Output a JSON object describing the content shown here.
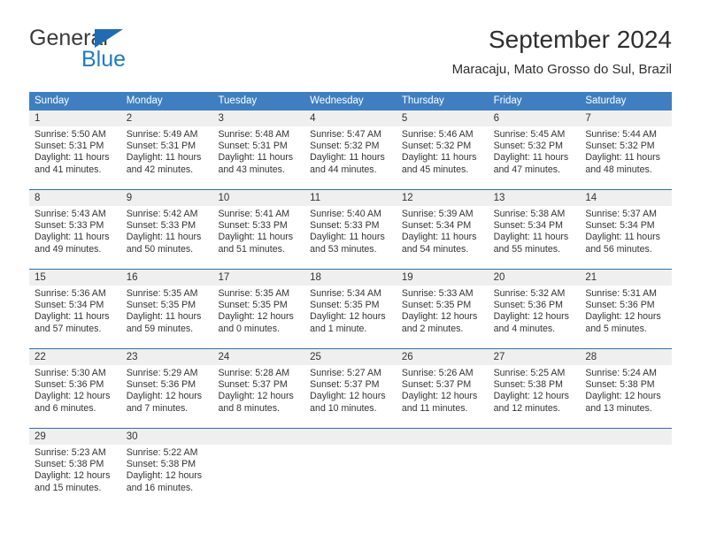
{
  "brand": {
    "line1": "General",
    "line2": "Blue",
    "triangle_color": "#1f6cb4",
    "blue_text_color": "#1f7bc4"
  },
  "header": {
    "title": "September 2024",
    "subtitle": "Maracaju, Mato Grosso do Sul, Brazil"
  },
  "theme": {
    "header_blue": "#3f7fc1",
    "row_border_blue": "#2f6fae",
    "day_band_gray": "#efefef"
  },
  "weekdays": [
    "Sunday",
    "Monday",
    "Tuesday",
    "Wednesday",
    "Thursday",
    "Friday",
    "Saturday"
  ],
  "weeks": [
    [
      {
        "day": "1",
        "sunrise": "Sunrise: 5:50 AM",
        "sunset": "Sunset: 5:31 PM",
        "daylight1": "Daylight: 11 hours",
        "daylight2": "and 41 minutes."
      },
      {
        "day": "2",
        "sunrise": "Sunrise: 5:49 AM",
        "sunset": "Sunset: 5:31 PM",
        "daylight1": "Daylight: 11 hours",
        "daylight2": "and 42 minutes."
      },
      {
        "day": "3",
        "sunrise": "Sunrise: 5:48 AM",
        "sunset": "Sunset: 5:31 PM",
        "daylight1": "Daylight: 11 hours",
        "daylight2": "and 43 minutes."
      },
      {
        "day": "4",
        "sunrise": "Sunrise: 5:47 AM",
        "sunset": "Sunset: 5:32 PM",
        "daylight1": "Daylight: 11 hours",
        "daylight2": "and 44 minutes."
      },
      {
        "day": "5",
        "sunrise": "Sunrise: 5:46 AM",
        "sunset": "Sunset: 5:32 PM",
        "daylight1": "Daylight: 11 hours",
        "daylight2": "and 45 minutes."
      },
      {
        "day": "6",
        "sunrise": "Sunrise: 5:45 AM",
        "sunset": "Sunset: 5:32 PM",
        "daylight1": "Daylight: 11 hours",
        "daylight2": "and 47 minutes."
      },
      {
        "day": "7",
        "sunrise": "Sunrise: 5:44 AM",
        "sunset": "Sunset: 5:32 PM",
        "daylight1": "Daylight: 11 hours",
        "daylight2": "and 48 minutes."
      }
    ],
    [
      {
        "day": "8",
        "sunrise": "Sunrise: 5:43 AM",
        "sunset": "Sunset: 5:33 PM",
        "daylight1": "Daylight: 11 hours",
        "daylight2": "and 49 minutes."
      },
      {
        "day": "9",
        "sunrise": "Sunrise: 5:42 AM",
        "sunset": "Sunset: 5:33 PM",
        "daylight1": "Daylight: 11 hours",
        "daylight2": "and 50 minutes."
      },
      {
        "day": "10",
        "sunrise": "Sunrise: 5:41 AM",
        "sunset": "Sunset: 5:33 PM",
        "daylight1": "Daylight: 11 hours",
        "daylight2": "and 51 minutes."
      },
      {
        "day": "11",
        "sunrise": "Sunrise: 5:40 AM",
        "sunset": "Sunset: 5:33 PM",
        "daylight1": "Daylight: 11 hours",
        "daylight2": "and 53 minutes."
      },
      {
        "day": "12",
        "sunrise": "Sunrise: 5:39 AM",
        "sunset": "Sunset: 5:34 PM",
        "daylight1": "Daylight: 11 hours",
        "daylight2": "and 54 minutes."
      },
      {
        "day": "13",
        "sunrise": "Sunrise: 5:38 AM",
        "sunset": "Sunset: 5:34 PM",
        "daylight1": "Daylight: 11 hours",
        "daylight2": "and 55 minutes."
      },
      {
        "day": "14",
        "sunrise": "Sunrise: 5:37 AM",
        "sunset": "Sunset: 5:34 PM",
        "daylight1": "Daylight: 11 hours",
        "daylight2": "and 56 minutes."
      }
    ],
    [
      {
        "day": "15",
        "sunrise": "Sunrise: 5:36 AM",
        "sunset": "Sunset: 5:34 PM",
        "daylight1": "Daylight: 11 hours",
        "daylight2": "and 57 minutes."
      },
      {
        "day": "16",
        "sunrise": "Sunrise: 5:35 AM",
        "sunset": "Sunset: 5:35 PM",
        "daylight1": "Daylight: 11 hours",
        "daylight2": "and 59 minutes."
      },
      {
        "day": "17",
        "sunrise": "Sunrise: 5:35 AM",
        "sunset": "Sunset: 5:35 PM",
        "daylight1": "Daylight: 12 hours",
        "daylight2": "and 0 minutes."
      },
      {
        "day": "18",
        "sunrise": "Sunrise: 5:34 AM",
        "sunset": "Sunset: 5:35 PM",
        "daylight1": "Daylight: 12 hours",
        "daylight2": "and 1 minute."
      },
      {
        "day": "19",
        "sunrise": "Sunrise: 5:33 AM",
        "sunset": "Sunset: 5:35 PM",
        "daylight1": "Daylight: 12 hours",
        "daylight2": "and 2 minutes."
      },
      {
        "day": "20",
        "sunrise": "Sunrise: 5:32 AM",
        "sunset": "Sunset: 5:36 PM",
        "daylight1": "Daylight: 12 hours",
        "daylight2": "and 4 minutes."
      },
      {
        "day": "21",
        "sunrise": "Sunrise: 5:31 AM",
        "sunset": "Sunset: 5:36 PM",
        "daylight1": "Daylight: 12 hours",
        "daylight2": "and 5 minutes."
      }
    ],
    [
      {
        "day": "22",
        "sunrise": "Sunrise: 5:30 AM",
        "sunset": "Sunset: 5:36 PM",
        "daylight1": "Daylight: 12 hours",
        "daylight2": "and 6 minutes."
      },
      {
        "day": "23",
        "sunrise": "Sunrise: 5:29 AM",
        "sunset": "Sunset: 5:36 PM",
        "daylight1": "Daylight: 12 hours",
        "daylight2": "and 7 minutes."
      },
      {
        "day": "24",
        "sunrise": "Sunrise: 5:28 AM",
        "sunset": "Sunset: 5:37 PM",
        "daylight1": "Daylight: 12 hours",
        "daylight2": "and 8 minutes."
      },
      {
        "day": "25",
        "sunrise": "Sunrise: 5:27 AM",
        "sunset": "Sunset: 5:37 PM",
        "daylight1": "Daylight: 12 hours",
        "daylight2": "and 10 minutes."
      },
      {
        "day": "26",
        "sunrise": "Sunrise: 5:26 AM",
        "sunset": "Sunset: 5:37 PM",
        "daylight1": "Daylight: 12 hours",
        "daylight2": "and 11 minutes."
      },
      {
        "day": "27",
        "sunrise": "Sunrise: 5:25 AM",
        "sunset": "Sunset: 5:38 PM",
        "daylight1": "Daylight: 12 hours",
        "daylight2": "and 12 minutes."
      },
      {
        "day": "28",
        "sunrise": "Sunrise: 5:24 AM",
        "sunset": "Sunset: 5:38 PM",
        "daylight1": "Daylight: 12 hours",
        "daylight2": "and 13 minutes."
      }
    ],
    [
      {
        "day": "29",
        "sunrise": "Sunrise: 5:23 AM",
        "sunset": "Sunset: 5:38 PM",
        "daylight1": "Daylight: 12 hours",
        "daylight2": "and 15 minutes."
      },
      {
        "day": "30",
        "sunrise": "Sunrise: 5:22 AM",
        "sunset": "Sunset: 5:38 PM",
        "daylight1": "Daylight: 12 hours",
        "daylight2": "and 16 minutes."
      },
      {
        "day": "",
        "sunrise": "",
        "sunset": "",
        "daylight1": "",
        "daylight2": ""
      },
      {
        "day": "",
        "sunrise": "",
        "sunset": "",
        "daylight1": "",
        "daylight2": ""
      },
      {
        "day": "",
        "sunrise": "",
        "sunset": "",
        "daylight1": "",
        "daylight2": ""
      },
      {
        "day": "",
        "sunrise": "",
        "sunset": "",
        "daylight1": "",
        "daylight2": ""
      },
      {
        "day": "",
        "sunrise": "",
        "sunset": "",
        "daylight1": "",
        "daylight2": ""
      }
    ]
  ]
}
